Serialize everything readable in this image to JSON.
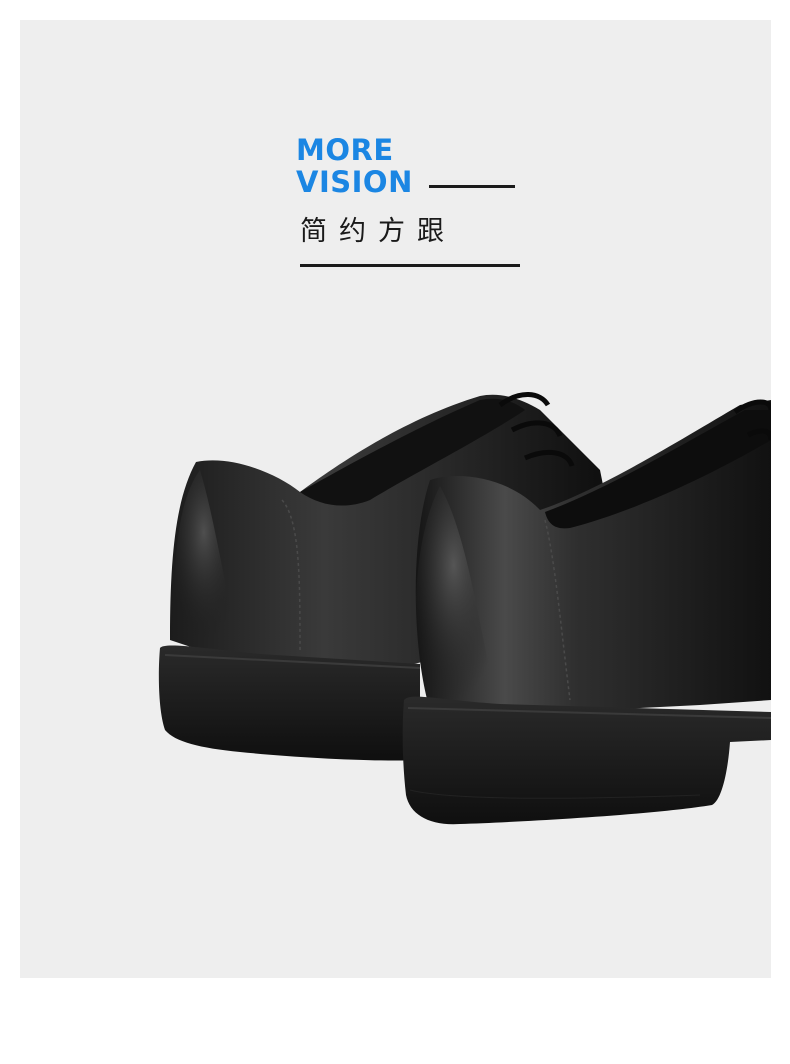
{
  "headline": {
    "line1": "MORE",
    "line2": "VISION"
  },
  "subtitle": "简约方跟",
  "colors": {
    "background": "#eeeeee",
    "accent": "#1b86e3",
    "text": "#1a1a1a"
  },
  "photo": {
    "subject": "black-leather-derby-shoes-icon"
  }
}
